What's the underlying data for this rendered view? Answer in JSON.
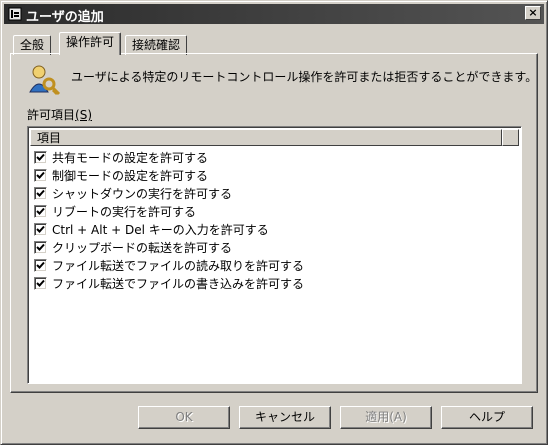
{
  "window": {
    "title": "ユーザの追加",
    "close_label": "×"
  },
  "tabs": [
    {
      "label": "全般",
      "active": false
    },
    {
      "label": "操作許可",
      "active": true
    },
    {
      "label": "接続確認",
      "active": false
    }
  ],
  "panel": {
    "description": "ユーザによる特定のリモートコントロール操作を許可または拒否することができます。",
    "permission_label": "許可項目",
    "permission_accel": "(S)",
    "column_header": "項目",
    "items": [
      {
        "label": "共有モードの設定を許可する",
        "checked": true
      },
      {
        "label": "制御モードの設定を許可する",
        "checked": true
      },
      {
        "label": "シャットダウンの実行を許可する",
        "checked": true
      },
      {
        "label": "リブートの実行を許可する",
        "checked": true
      },
      {
        "label": "Ctrl + Alt + Del キーの入力を許可する",
        "checked": true
      },
      {
        "label": "クリップボードの転送を許可する",
        "checked": true
      },
      {
        "label": "ファイル転送でファイルの読み取りを許可する",
        "checked": true
      },
      {
        "label": "ファイル転送でファイルの書き込みを許可する",
        "checked": true
      }
    ]
  },
  "buttons": {
    "ok": "OK",
    "cancel": "キャンセル",
    "apply": "適用(A)",
    "help": "ヘルプ"
  },
  "icons": {
    "title": "dialog-app-icon",
    "description": "user-key-icon",
    "checkbox": "checkmark-icon"
  }
}
